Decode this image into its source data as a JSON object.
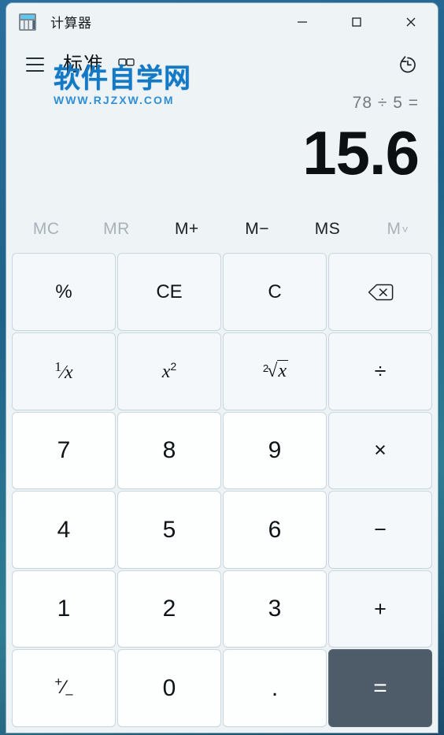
{
  "window": {
    "title": "计算器",
    "app_icon": "calculator-icon",
    "controls": {
      "minimize": "—",
      "maximize": "□",
      "close": "✕"
    }
  },
  "header": {
    "menu_icon": "hamburger-menu-icon",
    "mode_title": "标准",
    "pin_icon": "keep-on-top-icon",
    "history_icon": "history-icon"
  },
  "watermark": {
    "main": "软件自学网",
    "sub": "WWW.RJZXW.COM",
    "color": "#1479c4"
  },
  "display": {
    "expression": "78 ÷ 5 =",
    "result": "15.6"
  },
  "memory": {
    "buttons": [
      {
        "label": "MC",
        "enabled": false
      },
      {
        "label": "MR",
        "enabled": false
      },
      {
        "label": "M+",
        "enabled": true
      },
      {
        "label": "M−",
        "enabled": true
      },
      {
        "label": "MS",
        "enabled": true
      },
      {
        "label": "M",
        "enabled": false,
        "chevron": "˅"
      }
    ]
  },
  "keypad": {
    "rows": [
      [
        {
          "name": "percent",
          "label": "%",
          "type": "fn"
        },
        {
          "name": "clear-entry",
          "label": "CE",
          "type": "fn"
        },
        {
          "name": "clear",
          "label": "C",
          "type": "fn"
        },
        {
          "name": "backspace",
          "label": "",
          "type": "fn",
          "icon": "backspace-icon"
        }
      ],
      [
        {
          "name": "reciprocal",
          "label": "1/x",
          "type": "fn"
        },
        {
          "name": "square",
          "label": "x2",
          "type": "fn"
        },
        {
          "name": "square-root",
          "label": "2√x",
          "type": "fn"
        },
        {
          "name": "divide",
          "label": "÷",
          "type": "op"
        }
      ],
      [
        {
          "name": "seven",
          "label": "7",
          "type": "num"
        },
        {
          "name": "eight",
          "label": "8",
          "type": "num"
        },
        {
          "name": "nine",
          "label": "9",
          "type": "num"
        },
        {
          "name": "multiply",
          "label": "×",
          "type": "op"
        }
      ],
      [
        {
          "name": "four",
          "label": "4",
          "type": "num"
        },
        {
          "name": "five",
          "label": "5",
          "type": "num"
        },
        {
          "name": "six",
          "label": "6",
          "type": "num"
        },
        {
          "name": "subtract",
          "label": "−",
          "type": "op"
        }
      ],
      [
        {
          "name": "one",
          "label": "1",
          "type": "num"
        },
        {
          "name": "two",
          "label": "2",
          "type": "num"
        },
        {
          "name": "three",
          "label": "3",
          "type": "num"
        },
        {
          "name": "add",
          "label": "+",
          "type": "op"
        }
      ],
      [
        {
          "name": "negate",
          "label": "+/−",
          "type": "num"
        },
        {
          "name": "zero",
          "label": "0",
          "type": "num"
        },
        {
          "name": "decimal-point",
          "label": ".",
          "type": "num"
        },
        {
          "name": "equals",
          "label": "=",
          "type": "equals"
        }
      ]
    ]
  },
  "colors": {
    "window_bg": "#eef3f5",
    "number_key": "#fdfefe",
    "operator_key": "#f4f8fa",
    "equals_key": "#4d5c68",
    "text": "#0f1418",
    "disabled_text": "#a9b2b9",
    "desktop": "#2a6e9e"
  }
}
